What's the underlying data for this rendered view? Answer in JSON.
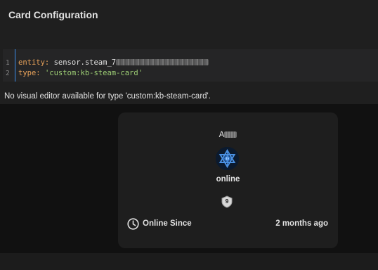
{
  "header": {
    "title": "Card Configuration"
  },
  "editor": {
    "lines": [
      {
        "number": "1",
        "key": "entity:",
        "value": " sensor.steam_7"
      },
      {
        "number": "2",
        "key": "type:",
        "value": "'custom:kb-steam-card'"
      }
    ]
  },
  "notice": "No visual editor available for type 'custom:kb-steam-card'.",
  "card": {
    "player_name": "A",
    "avatar_icon": "steam-hexagram-avatar",
    "status": "online",
    "level": "9",
    "row": {
      "icon": "clock-icon",
      "label": "Online Since",
      "value": "2 months ago"
    }
  },
  "colors": {
    "editor_key": "#e8a25a",
    "editor_string": "#9ccc74",
    "gutter_line": "#3b8eea",
    "avatar_blue": "#4a90e2"
  }
}
